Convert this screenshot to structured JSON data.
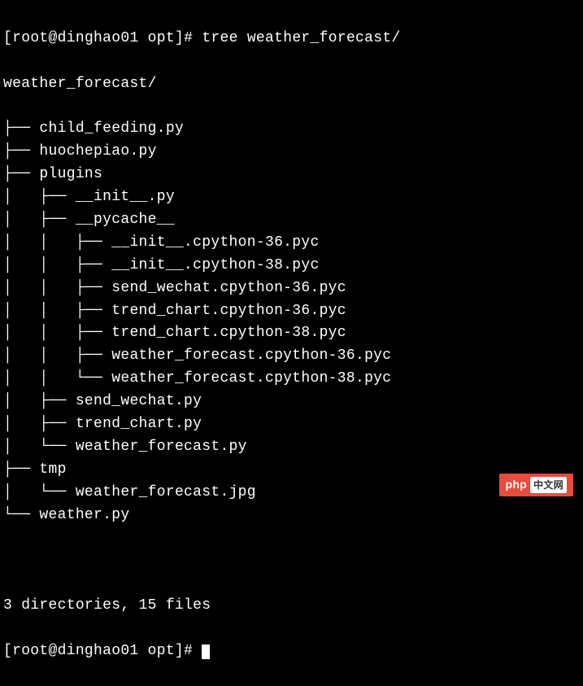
{
  "prompt": {
    "user": "root",
    "host": "dinghao01",
    "path": "opt",
    "symbol": "#",
    "command": "tree weather_forecast/"
  },
  "tree": {
    "root": "weather_forecast/",
    "lines": [
      {
        "prefix": "├── ",
        "name": "child_feeding.py"
      },
      {
        "prefix": "├── ",
        "name": "huochepiao.py"
      },
      {
        "prefix": "├── ",
        "name": "plugins"
      },
      {
        "prefix": "│   ├── ",
        "name": "__init__.py"
      },
      {
        "prefix": "│   ├── ",
        "name": "__pycache__"
      },
      {
        "prefix": "│   │   ├── ",
        "name": "__init__.cpython-36.pyc"
      },
      {
        "prefix": "│   │   ├── ",
        "name": "__init__.cpython-38.pyc"
      },
      {
        "prefix": "│   │   ├── ",
        "name": "send_wechat.cpython-36.pyc"
      },
      {
        "prefix": "│   │   ├── ",
        "name": "trend_chart.cpython-36.pyc"
      },
      {
        "prefix": "│   │   ├── ",
        "name": "trend_chart.cpython-38.pyc"
      },
      {
        "prefix": "│   │   ├── ",
        "name": "weather_forecast.cpython-36.pyc"
      },
      {
        "prefix": "│   │   └── ",
        "name": "weather_forecast.cpython-38.pyc"
      },
      {
        "prefix": "│   ├── ",
        "name": "send_wechat.py"
      },
      {
        "prefix": "│   ├── ",
        "name": "trend_chart.py"
      },
      {
        "prefix": "│   └── ",
        "name": "weather_forecast.py"
      },
      {
        "prefix": "├── ",
        "name": "tmp"
      },
      {
        "prefix": "│   └── ",
        "name": "weather_forecast.jpg"
      },
      {
        "prefix": "└── ",
        "name": "weather.py"
      }
    ],
    "summary": "3 directories, 15 files"
  },
  "prompt2": {
    "text": "[root@dinghao01 opt]# "
  },
  "watermark": {
    "label": "php",
    "cn": "中文网"
  }
}
